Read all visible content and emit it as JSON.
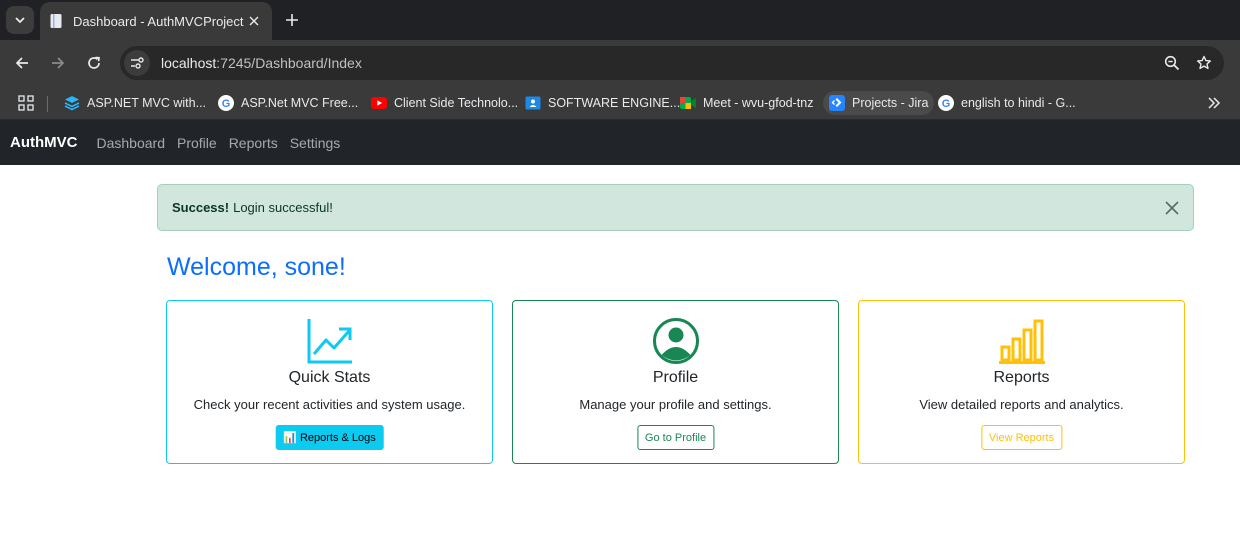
{
  "browser": {
    "tab": {
      "title": "Dashboard - AuthMVCProject"
    },
    "address": {
      "host": "localhost",
      "path": ":7245/Dashboard/Index"
    },
    "bookmarks": [
      {
        "label": "ASP.NET MVC with...",
        "icon": "layers-icon",
        "color": "#2196f3"
      },
      {
        "label": "ASP.Net MVC Free...",
        "icon": "google-g-icon",
        "color": "#ffffff"
      },
      {
        "label": "Client Side Technolo...",
        "icon": "youtube-icon",
        "color": "#ff0000"
      },
      {
        "label": "SOFTWARE ENGINE...",
        "icon": "classroom-icon",
        "color": "#1e88e5"
      },
      {
        "label": "Meet - wvu-gfod-tnz",
        "icon": "meet-icon",
        "color": "#00ac47"
      },
      {
        "label": "Projects - Jira",
        "icon": "jira-icon",
        "color": "#2684ff"
      },
      {
        "label": "english to hindi - G...",
        "icon": "google-g-icon",
        "color": "#ffffff"
      }
    ]
  },
  "app": {
    "brand": "AuthMVC",
    "nav": [
      "Dashboard",
      "Profile",
      "Reports",
      "Settings"
    ]
  },
  "alert": {
    "strong": "Success!",
    "message": "Login successful!"
  },
  "welcome": "Welcome, sone!",
  "cards": [
    {
      "title": "Quick Stats",
      "text": "Check your recent activities and system usage.",
      "button": "📊 Reports & Logs",
      "icon": "graph-up-arrow-icon",
      "color": "#0dcaf0"
    },
    {
      "title": "Profile",
      "text": "Manage your profile and settings.",
      "button": "Go to Profile",
      "icon": "person-circle-icon",
      "color": "#198754"
    },
    {
      "title": "Reports",
      "text": "View detailed reports and analytics.",
      "button": "View Reports",
      "icon": "bar-chart-icon",
      "color": "#ffc107"
    }
  ]
}
